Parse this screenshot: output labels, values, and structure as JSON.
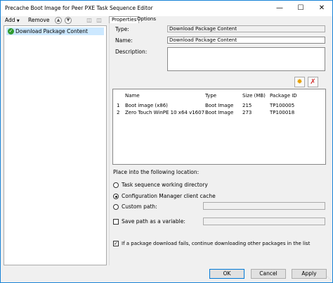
{
  "window": {
    "title": "Precache Boot Image for Peer PXE Task Sequence Editor",
    "minimize": "—",
    "maximize": "☐",
    "close": "✕"
  },
  "toolbar": {
    "add_label": "Add",
    "remove_label": "Remove"
  },
  "tree": {
    "items": [
      {
        "label": "Download Package Content",
        "status": "success"
      }
    ]
  },
  "tabs": [
    {
      "label": "Properties",
      "active": true
    },
    {
      "label": "Options",
      "active": false
    }
  ],
  "properties": {
    "type_label": "Type:",
    "type_value": "Download Package Content",
    "name_label": "Name:",
    "name_value": "Download Package Content",
    "description_label": "Description:",
    "description_value": ""
  },
  "packages": {
    "columns": [
      "Name",
      "Type",
      "Size (MB)",
      "Package ID"
    ],
    "rows": [
      {
        "index": "1",
        "name": "Boot image (x86)",
        "type": "Boot Image",
        "size": "215",
        "id": "TP100005"
      },
      {
        "index": "2",
        "name": "Zero Touch WinPE 10 x64 v1607",
        "type": "Boot Image",
        "size": "273",
        "id": "TP100018"
      }
    ]
  },
  "location": {
    "heading": "Place into the following location:",
    "options": [
      {
        "label": "Task sequence working directory",
        "selected": false
      },
      {
        "label": "Configuration Manager client cache",
        "selected": true
      },
      {
        "label": "Custom path:",
        "selected": false
      }
    ],
    "custom_path_value": "",
    "save_path_label": "Save path as a variable:",
    "save_path_checked": false,
    "save_path_value": "",
    "continue_label": "If a package download fails, continue downloading other packages in the list",
    "continue_checked": true
  },
  "buttons": {
    "ok": "OK",
    "cancel": "Cancel",
    "apply": "Apply"
  },
  "colors": {
    "accent": "#0078d7",
    "selection": "#cce8ff",
    "success": "#2e9a2e",
    "delete": "#d32f2f"
  }
}
